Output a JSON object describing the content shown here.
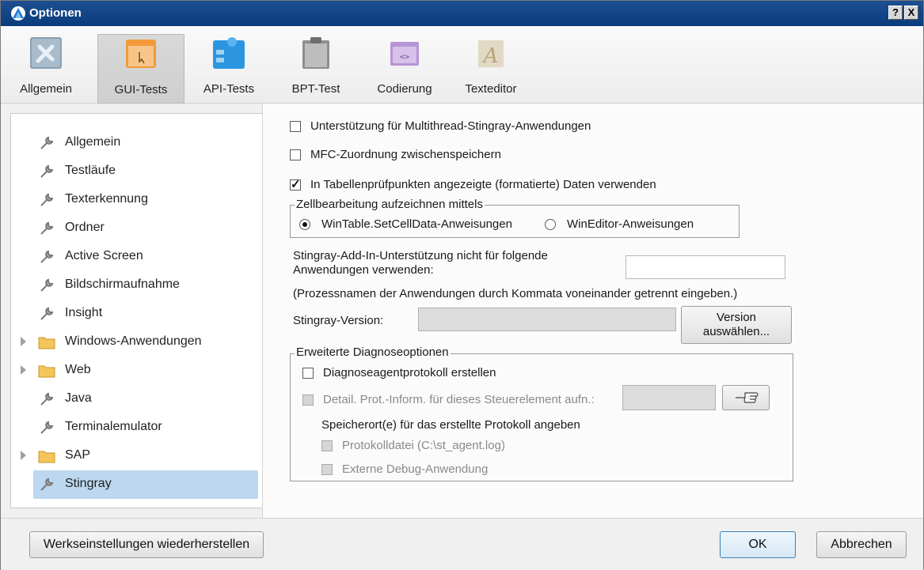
{
  "window": {
    "title": "Optionen",
    "help_button": "?",
    "close_button": "X"
  },
  "tabs": [
    {
      "label": "Allgemein",
      "icon": "tools-icon"
    },
    {
      "label": "GUI-Tests",
      "icon": "gui-test-icon",
      "selected": true
    },
    {
      "label": "API-Tests",
      "icon": "api-test-icon"
    },
    {
      "label": "BPT-Test",
      "icon": "clipboard-icon"
    },
    {
      "label": "Codierung",
      "icon": "code-window-icon"
    },
    {
      "label": "Texteditor",
      "icon": "text-editor-icon"
    }
  ],
  "nav": {
    "items": [
      {
        "label": "Allgemein",
        "icon": "wrench-icon"
      },
      {
        "label": "Testläufe",
        "icon": "wrench-icon"
      },
      {
        "label": "Texterkennung",
        "icon": "wrench-icon"
      },
      {
        "label": "Ordner",
        "icon": "wrench-icon"
      },
      {
        "label": "Active Screen",
        "icon": "wrench-icon"
      },
      {
        "label": "Bildschirmaufnahme",
        "icon": "wrench-icon"
      },
      {
        "label": "Insight",
        "icon": "wrench-icon"
      },
      {
        "label": "Windows-Anwendungen",
        "icon": "folder-icon",
        "expandable": true
      },
      {
        "label": "Web",
        "icon": "folder-icon",
        "expandable": true
      },
      {
        "label": "Java",
        "icon": "wrench-icon"
      },
      {
        "label": "Terminalemulator",
        "icon": "wrench-icon"
      },
      {
        "label": "SAP",
        "icon": "folder-icon",
        "expandable": true
      },
      {
        "label": "Stingray",
        "icon": "wrench-icon",
        "selected": true
      }
    ]
  },
  "stingray": {
    "multithread_label": "Unterstützung für Multithread-Stingray-Anwendungen",
    "multithread_checked": false,
    "mfc_label": "MFC-Zuordnung zwischenspeichern",
    "mfc_checked": false,
    "formatted_label": "In Tabellenprüfpunkten angezeigte (formatierte) Daten verwenden",
    "formatted_checked": true,
    "cell_group_title": "Zellbearbeitung aufzeichnen mittels",
    "radio_wintable": "WinTable.SetCellData-Anweisungen",
    "radio_wineditor": "WinEditor-Anweisungen",
    "selected_radio": "WinTable.SetCellData-Anweisungen",
    "exclude_label_line1": "Stingray-Add-In-Unterstützung nicht für folgende",
    "exclude_label_line2": "Anwendungen verwenden:",
    "exclude_value": "",
    "exclude_hint": "(Prozessnamen der Anwendungen durch Kommata voneinander getrennt eingeben.)",
    "version_label": "Stingray-Version:",
    "version_value": "",
    "version_button_line1": "Version",
    "version_button_line2": "auswählen...",
    "diag_group_title": "Erweiterte Diagnoseoptionen",
    "diag_agent_label": "Diagnoseagentprotokoll erstellen",
    "diag_agent_checked": false,
    "detail_label": "Detail. Prot.-Inform. für dieses Steuerelement aufn.:",
    "detail_value": "",
    "storage_label": "Speicherort(e) für das erstellte Protokoll angeben",
    "logfile_label": "Protokolldatei (C:\\st_agent.log)",
    "debug_label": "Externe Debug-Anwendung"
  },
  "footer": {
    "restore_label": "Werkseinstellungen wiederherstellen",
    "ok_label": "OK",
    "cancel_label": "Abbrechen"
  },
  "colors": {
    "titlebar": "#0a3b7d",
    "selected_nav": "#bcd7ef",
    "ok_button_border": "#3c7fb1"
  }
}
